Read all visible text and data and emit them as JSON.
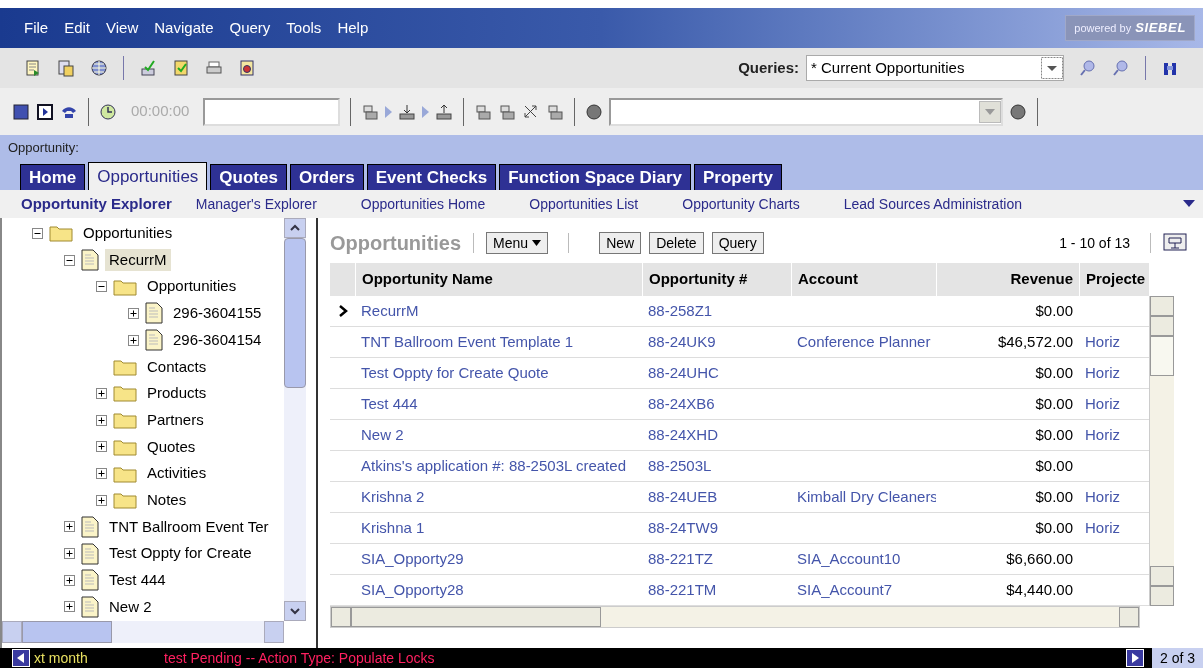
{
  "menu_bar": {
    "items": [
      "File",
      "Edit",
      "View",
      "Navigate",
      "Query",
      "Tools",
      "Help"
    ],
    "logo": {
      "prefix": "powered by",
      "brand": "SIEBEL"
    }
  },
  "toolbar": {
    "queries_label": "Queries:",
    "queries_value": "* Current Opportunities"
  },
  "comm_toolbar": {
    "timer": "00:00:00"
  },
  "screen_label": "Opportunity:",
  "tabs": [
    {
      "label": "Home",
      "selected": false
    },
    {
      "label": "Opportunities",
      "selected": true
    },
    {
      "label": "Quotes",
      "selected": false
    },
    {
      "label": "Orders",
      "selected": false
    },
    {
      "label": "Event Checks",
      "selected": false
    },
    {
      "label": "Function Space Diary",
      "selected": false
    },
    {
      "label": "Property",
      "selected": false
    }
  ],
  "subnav": [
    {
      "label": "Opportunity Explorer",
      "selected": true
    },
    {
      "label": "Manager's Explorer",
      "selected": false
    },
    {
      "label": "Opportunities Home",
      "selected": false
    },
    {
      "label": "Opportunities List",
      "selected": false
    },
    {
      "label": "Opportunity Charts",
      "selected": false
    },
    {
      "label": "Lead Sources Administration",
      "selected": false
    }
  ],
  "tree": [
    {
      "label": "Opportunities",
      "kind": "folder",
      "expanded": true,
      "selected": false,
      "children": [
        {
          "label": "RecurrM",
          "kind": "record",
          "expanded": true,
          "selected": true,
          "children": [
            {
              "label": "Opportunities",
              "kind": "folder",
              "expanded": true,
              "selected": false,
              "children": [
                {
                  "label": "296-3604155",
                  "kind": "record",
                  "expanded": false,
                  "selected": false
                },
                {
                  "label": "296-3604154",
                  "kind": "record",
                  "expanded": false,
                  "selected": false
                }
              ]
            },
            {
              "label": "Contacts",
              "kind": "folder",
              "selected": false
            },
            {
              "label": "Products",
              "kind": "folder",
              "expanded": false,
              "selected": false
            },
            {
              "label": "Partners",
              "kind": "folder",
              "expanded": false,
              "selected": false
            },
            {
              "label": "Quotes",
              "kind": "folder",
              "expanded": false,
              "selected": false
            },
            {
              "label": "Activities",
              "kind": "folder",
              "expanded": false,
              "selected": false
            },
            {
              "label": "Notes",
              "kind": "folder",
              "expanded": false,
              "selected": false
            }
          ]
        },
        {
          "label": "TNT Ballroom Event Ter",
          "kind": "record",
          "expanded": false,
          "selected": false
        },
        {
          "label": "Test Oppty for Create",
          "kind": "record",
          "expanded": false,
          "selected": false
        },
        {
          "label": "Test 444",
          "kind": "record",
          "expanded": false,
          "selected": false
        },
        {
          "label": "New 2",
          "kind": "record",
          "expanded": false,
          "selected": false
        }
      ]
    }
  ],
  "list": {
    "title": "Opportunities",
    "buttons": [
      "Menu",
      "New",
      "Delete",
      "Query"
    ],
    "record_count": "1 - 10 of 13",
    "columns": [
      "Opportunity Name",
      "Opportunity #",
      "Account",
      "Revenue",
      "Projecte"
    ],
    "rows": [
      {
        "selected": true,
        "cells": [
          "RecurrM",
          "88-258Z1",
          "",
          "$0.00",
          ""
        ]
      },
      {
        "selected": false,
        "cells": [
          "TNT Ballroom Event Template 1",
          "88-24UK9",
          "Conference Planner",
          "$46,572.00",
          "Horiz"
        ]
      },
      {
        "selected": false,
        "cells": [
          "Test Oppty for Create Quote",
          "88-24UHC",
          "",
          "$0.00",
          "Horiz"
        ]
      },
      {
        "selected": false,
        "cells": [
          "Test 444",
          "88-24XB6",
          "",
          "$0.00",
          "Horiz"
        ]
      },
      {
        "selected": false,
        "cells": [
          "New 2",
          "88-24XHD",
          "",
          "$0.00",
          "Horiz"
        ]
      },
      {
        "selected": false,
        "cells": [
          "Atkins's application #: 88-2503L created",
          "88-2503L",
          "",
          "$0.00",
          ""
        ]
      },
      {
        "selected": false,
        "cells": [
          "Krishna 2",
          "88-24UEB",
          "Kimball Dry Cleaners",
          "$0.00",
          "Horiz"
        ]
      },
      {
        "selected": false,
        "cells": [
          "Krishna 1",
          "88-24TW9",
          "",
          "$0.00",
          "Horiz"
        ]
      },
      {
        "selected": false,
        "cells": [
          "SIA_Opporty29",
          "88-221TZ",
          "SIA_Account10",
          "$6,660.00",
          ""
        ]
      },
      {
        "selected": false,
        "cells": [
          "SIA_Opporty28",
          "88-221TM",
          "SIA_Account7",
          "$4,440.00",
          ""
        ]
      }
    ]
  },
  "status_bar": {
    "message_tail": "xt month",
    "alert": "test Pending -- Action Type: Populate Locks",
    "page": "2 of 3"
  }
}
